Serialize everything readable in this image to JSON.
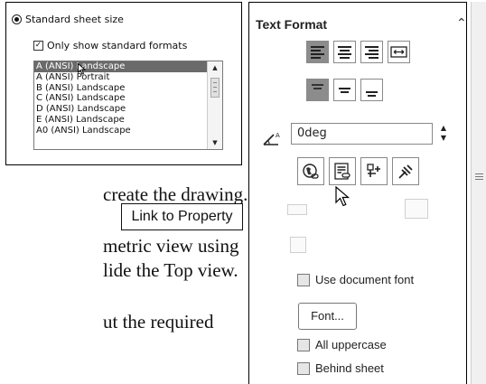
{
  "sheet_panel": {
    "standard_sheet_size_label": "Standard sheet size",
    "only_standard_formats_label": "Only show standard formats",
    "formats": [
      "A (ANSI) Landscape",
      "A (ANSI) Portrait",
      "B (ANSI) Landscape",
      "C (ANSI) Landscape",
      "D (ANSI) Landscape",
      "E (ANSI) Landscape",
      "A0 (ANSI) Landscape"
    ],
    "selected_format": "A (ANSI) Landscape"
  },
  "document": {
    "line1": "create the drawing.",
    "line2": "metric view using",
    "line3": "lide the Top view.",
    "line4": "ut the required"
  },
  "text_format_panel": {
    "title": "Text Format",
    "angle_value": "0deg",
    "tooltip": "Link to Property",
    "use_document_font_label": "Use document font",
    "font_button_label": "Font...",
    "all_uppercase_label": "All uppercase",
    "behind_sheet_label": "Behind sheet"
  },
  "colors": {
    "selected_row": "#6a6a6a",
    "pressed_button": "#8c8c8c"
  }
}
